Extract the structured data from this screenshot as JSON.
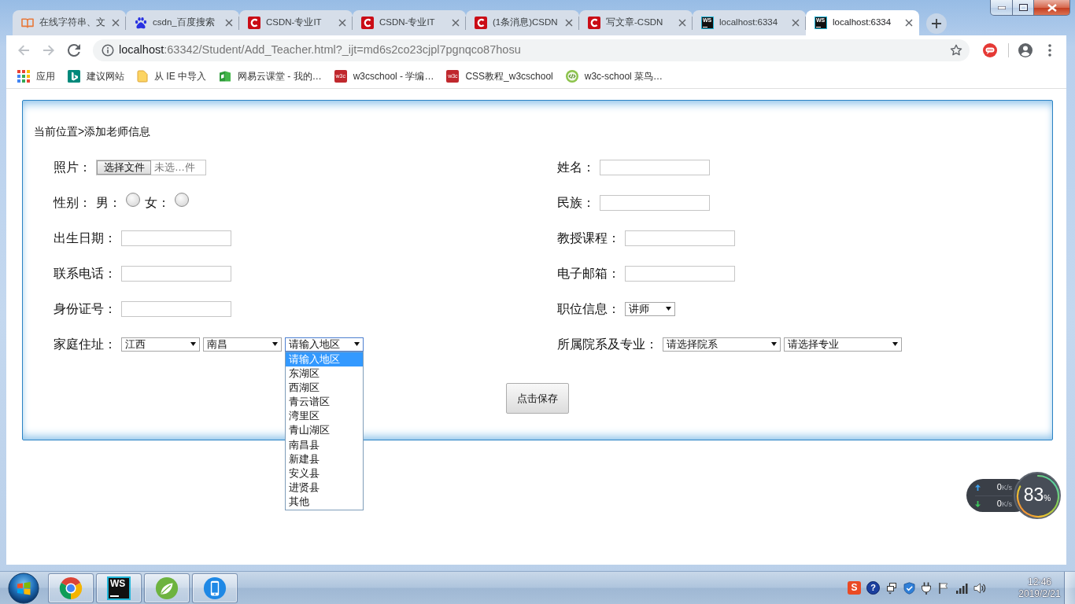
{
  "browser": {
    "tabs": [
      {
        "kind": "book",
        "title": "在线字符串、文",
        "selected": false
      },
      {
        "kind": "paw",
        "title": "csdn_百度搜索",
        "selected": false
      },
      {
        "kind": "c-logo",
        "title": "CSDN-专业IT",
        "selected": false
      },
      {
        "kind": "c-logo",
        "title": "CSDN-专业IT",
        "selected": false
      },
      {
        "kind": "c-logo",
        "title": "(1条消息)CSDN",
        "selected": false
      },
      {
        "kind": "c-logo",
        "title": "写文章-CSDN",
        "selected": false
      },
      {
        "kind": "ws",
        "icon_text": "WS",
        "title": "localhost:6334",
        "selected": false
      },
      {
        "kind": "ws",
        "icon_text": "WS",
        "title": "localhost:6334",
        "selected": true
      }
    ],
    "address": {
      "host": "localhost",
      "rest": ":63342/Student/Add_Teacher.html?_ijt=md6s2co23cjpl7pgnqco87hosu"
    },
    "bookmarks": [
      {
        "kind": "apps",
        "label": "应用"
      },
      {
        "kind": "tile",
        "label": "建议网站"
      },
      {
        "kind": "folder",
        "label": "从 IE 中导入"
      },
      {
        "kind": "book",
        "label": "网易云课堂 - 我的…"
      },
      {
        "kind": "w3c",
        "icon_text": "w3c",
        "label": "w3cschool - 学编…"
      },
      {
        "kind": "w3c",
        "icon_text": "w3c",
        "label": "CSS教程_w3cschool"
      },
      {
        "kind": "code",
        "label": "w3c-school 菜鸟…"
      }
    ]
  },
  "page": {
    "breadcrumb": "当前位置>添加老师信息",
    "left_fields": [
      {
        "kind": "file",
        "label": "照片：",
        "button": "选择文件",
        "placeholder": "未选…件"
      },
      {
        "kind": "radio",
        "label": "性别：",
        "options": [
          {
            "label": "男：",
            "selected": false
          },
          {
            "label": "女：",
            "selected": false
          }
        ]
      },
      {
        "kind": "text",
        "label": "出生日期："
      },
      {
        "kind": "text",
        "label": "联系电话："
      },
      {
        "kind": "text",
        "label": "身份证号："
      },
      {
        "kind": "selects",
        "label": "家庭住址：",
        "selects": [
          {
            "value": "江西",
            "open": false
          },
          {
            "value": "南昌",
            "open": false
          },
          {
            "value": "请输入地区",
            "open": true,
            "options": [
              {
                "label": "请输入地区",
                "selected": true
              },
              {
                "label": "东湖区",
                "selected": false
              },
              {
                "label": "西湖区",
                "selected": false
              },
              {
                "label": "青云谱区",
                "selected": false
              },
              {
                "label": "湾里区",
                "selected": false
              },
              {
                "label": "青山湖区",
                "selected": false
              },
              {
                "label": "南昌县",
                "selected": false
              },
              {
                "label": "新建县",
                "selected": false
              },
              {
                "label": "安义县",
                "selected": false
              },
              {
                "label": "进贤县",
                "selected": false
              },
              {
                "label": "其他",
                "selected": false
              }
            ]
          }
        ]
      }
    ],
    "right_fields": [
      {
        "kind": "text",
        "label": "姓名："
      },
      {
        "kind": "text",
        "label": "民族："
      },
      {
        "kind": "text",
        "label": "教授课程："
      },
      {
        "kind": "text",
        "label": "电子邮箱："
      },
      {
        "kind": "selects",
        "label": "职位信息：",
        "selects": [
          {
            "value": "讲师",
            "open": false
          }
        ]
      },
      {
        "kind": "selects",
        "label": "所属院系及专业：",
        "selects": [
          {
            "value": "请选择院系",
            "open": false
          },
          {
            "value": "请选择专业",
            "open": false
          }
        ]
      }
    ],
    "save_button": "点击保存"
  },
  "net_monitor": {
    "upload": {
      "value": "0",
      "unit": "K/s"
    },
    "download": {
      "value": "0",
      "unit": "K/s"
    },
    "percent": "83",
    "percent_sign": "%"
  },
  "taskbar": {
    "apps": [
      {
        "kind": "browser"
      },
      {
        "kind": "ws",
        "icon_text": "WS"
      },
      {
        "kind": "leaf"
      },
      {
        "kind": "phone"
      }
    ],
    "tray": [
      {
        "kind": "ime",
        "icon_text": "S"
      },
      {
        "kind": "help",
        "icon_text": "?"
      },
      {
        "kind": "windows"
      },
      {
        "kind": "shield"
      },
      {
        "kind": "plug"
      },
      {
        "kind": "flag"
      },
      {
        "kind": "signal"
      },
      {
        "kind": "speaker"
      }
    ],
    "clock": {
      "time": "12:46",
      "date": "2019/2/21"
    }
  }
}
